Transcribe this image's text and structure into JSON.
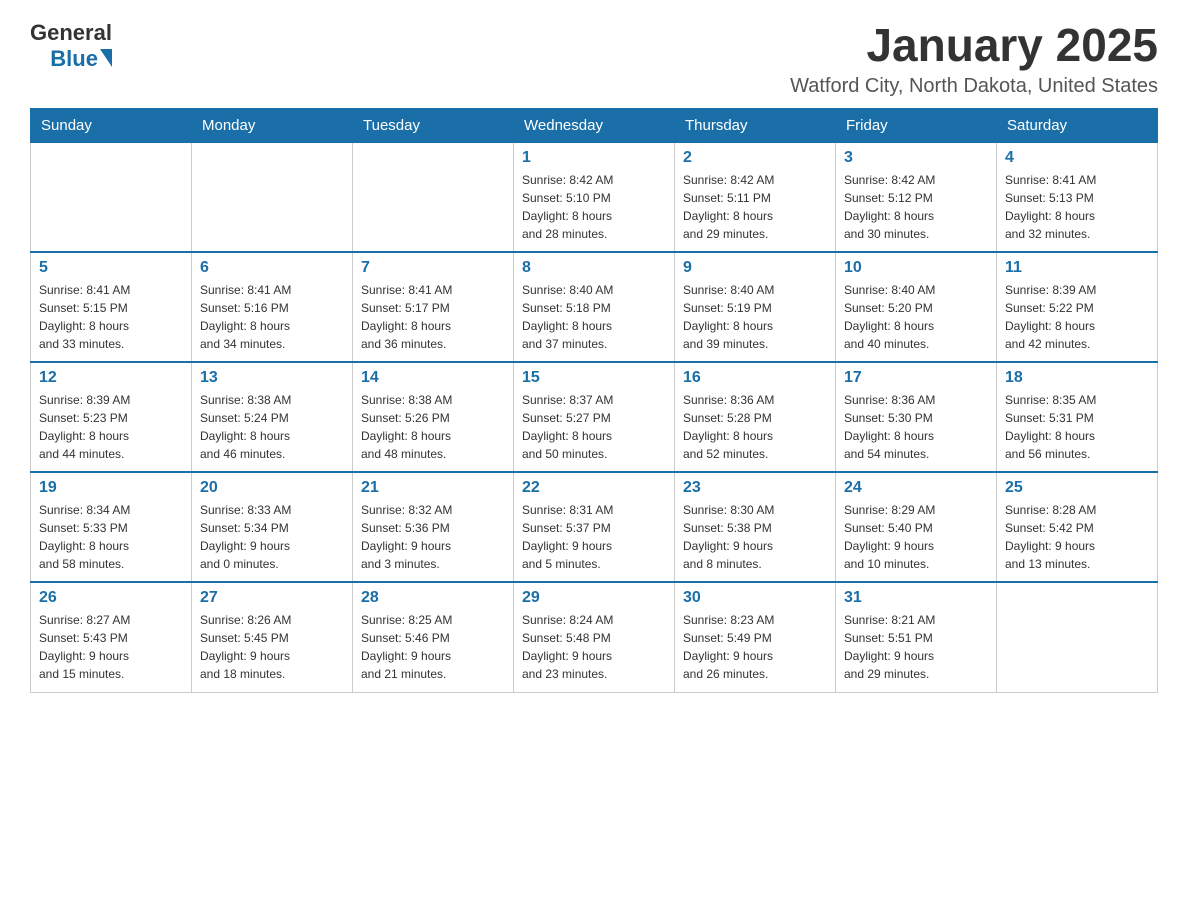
{
  "logo": {
    "general": "General",
    "blue": "Blue"
  },
  "title": "January 2025",
  "location": "Watford City, North Dakota, United States",
  "weekdays": [
    "Sunday",
    "Monday",
    "Tuesday",
    "Wednesday",
    "Thursday",
    "Friday",
    "Saturday"
  ],
  "weeks": [
    [
      {
        "day": "",
        "info": ""
      },
      {
        "day": "",
        "info": ""
      },
      {
        "day": "",
        "info": ""
      },
      {
        "day": "1",
        "info": "Sunrise: 8:42 AM\nSunset: 5:10 PM\nDaylight: 8 hours\nand 28 minutes."
      },
      {
        "day": "2",
        "info": "Sunrise: 8:42 AM\nSunset: 5:11 PM\nDaylight: 8 hours\nand 29 minutes."
      },
      {
        "day": "3",
        "info": "Sunrise: 8:42 AM\nSunset: 5:12 PM\nDaylight: 8 hours\nand 30 minutes."
      },
      {
        "day": "4",
        "info": "Sunrise: 8:41 AM\nSunset: 5:13 PM\nDaylight: 8 hours\nand 32 minutes."
      }
    ],
    [
      {
        "day": "5",
        "info": "Sunrise: 8:41 AM\nSunset: 5:15 PM\nDaylight: 8 hours\nand 33 minutes."
      },
      {
        "day": "6",
        "info": "Sunrise: 8:41 AM\nSunset: 5:16 PM\nDaylight: 8 hours\nand 34 minutes."
      },
      {
        "day": "7",
        "info": "Sunrise: 8:41 AM\nSunset: 5:17 PM\nDaylight: 8 hours\nand 36 minutes."
      },
      {
        "day": "8",
        "info": "Sunrise: 8:40 AM\nSunset: 5:18 PM\nDaylight: 8 hours\nand 37 minutes."
      },
      {
        "day": "9",
        "info": "Sunrise: 8:40 AM\nSunset: 5:19 PM\nDaylight: 8 hours\nand 39 minutes."
      },
      {
        "day": "10",
        "info": "Sunrise: 8:40 AM\nSunset: 5:20 PM\nDaylight: 8 hours\nand 40 minutes."
      },
      {
        "day": "11",
        "info": "Sunrise: 8:39 AM\nSunset: 5:22 PM\nDaylight: 8 hours\nand 42 minutes."
      }
    ],
    [
      {
        "day": "12",
        "info": "Sunrise: 8:39 AM\nSunset: 5:23 PM\nDaylight: 8 hours\nand 44 minutes."
      },
      {
        "day": "13",
        "info": "Sunrise: 8:38 AM\nSunset: 5:24 PM\nDaylight: 8 hours\nand 46 minutes."
      },
      {
        "day": "14",
        "info": "Sunrise: 8:38 AM\nSunset: 5:26 PM\nDaylight: 8 hours\nand 48 minutes."
      },
      {
        "day": "15",
        "info": "Sunrise: 8:37 AM\nSunset: 5:27 PM\nDaylight: 8 hours\nand 50 minutes."
      },
      {
        "day": "16",
        "info": "Sunrise: 8:36 AM\nSunset: 5:28 PM\nDaylight: 8 hours\nand 52 minutes."
      },
      {
        "day": "17",
        "info": "Sunrise: 8:36 AM\nSunset: 5:30 PM\nDaylight: 8 hours\nand 54 minutes."
      },
      {
        "day": "18",
        "info": "Sunrise: 8:35 AM\nSunset: 5:31 PM\nDaylight: 8 hours\nand 56 minutes."
      }
    ],
    [
      {
        "day": "19",
        "info": "Sunrise: 8:34 AM\nSunset: 5:33 PM\nDaylight: 8 hours\nand 58 minutes."
      },
      {
        "day": "20",
        "info": "Sunrise: 8:33 AM\nSunset: 5:34 PM\nDaylight: 9 hours\nand 0 minutes."
      },
      {
        "day": "21",
        "info": "Sunrise: 8:32 AM\nSunset: 5:36 PM\nDaylight: 9 hours\nand 3 minutes."
      },
      {
        "day": "22",
        "info": "Sunrise: 8:31 AM\nSunset: 5:37 PM\nDaylight: 9 hours\nand 5 minutes."
      },
      {
        "day": "23",
        "info": "Sunrise: 8:30 AM\nSunset: 5:38 PM\nDaylight: 9 hours\nand 8 minutes."
      },
      {
        "day": "24",
        "info": "Sunrise: 8:29 AM\nSunset: 5:40 PM\nDaylight: 9 hours\nand 10 minutes."
      },
      {
        "day": "25",
        "info": "Sunrise: 8:28 AM\nSunset: 5:42 PM\nDaylight: 9 hours\nand 13 minutes."
      }
    ],
    [
      {
        "day": "26",
        "info": "Sunrise: 8:27 AM\nSunset: 5:43 PM\nDaylight: 9 hours\nand 15 minutes."
      },
      {
        "day": "27",
        "info": "Sunrise: 8:26 AM\nSunset: 5:45 PM\nDaylight: 9 hours\nand 18 minutes."
      },
      {
        "day": "28",
        "info": "Sunrise: 8:25 AM\nSunset: 5:46 PM\nDaylight: 9 hours\nand 21 minutes."
      },
      {
        "day": "29",
        "info": "Sunrise: 8:24 AM\nSunset: 5:48 PM\nDaylight: 9 hours\nand 23 minutes."
      },
      {
        "day": "30",
        "info": "Sunrise: 8:23 AM\nSunset: 5:49 PM\nDaylight: 9 hours\nand 26 minutes."
      },
      {
        "day": "31",
        "info": "Sunrise: 8:21 AM\nSunset: 5:51 PM\nDaylight: 9 hours\nand 29 minutes."
      },
      {
        "day": "",
        "info": ""
      }
    ]
  ]
}
